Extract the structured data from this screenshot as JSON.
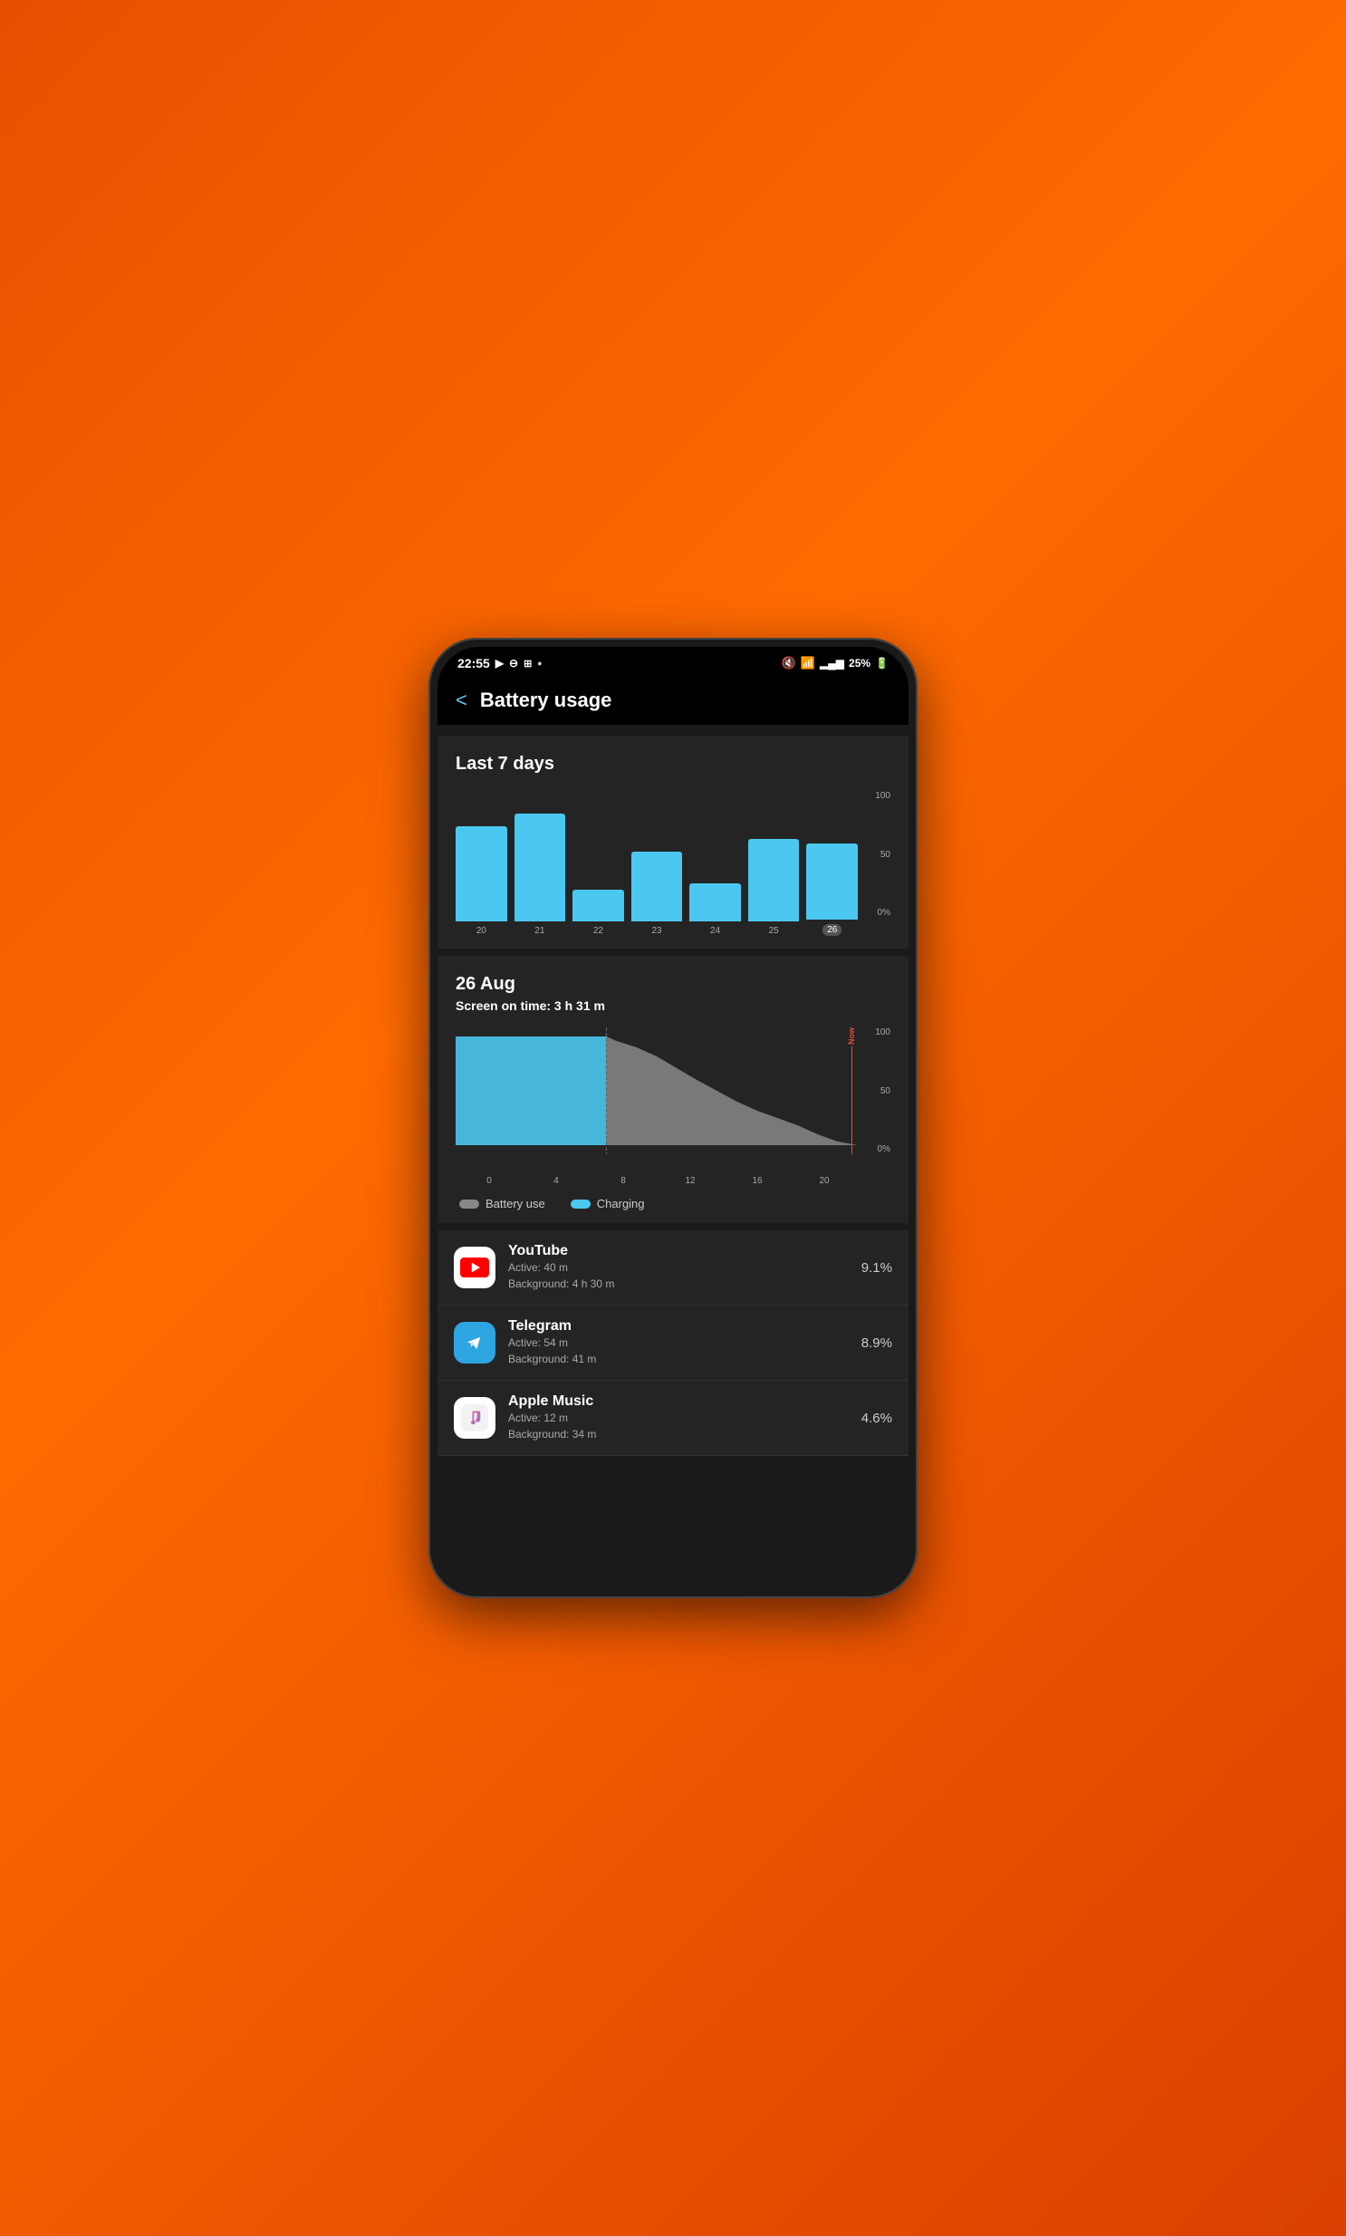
{
  "statusBar": {
    "time": "22:55",
    "battery": "25%",
    "icons": [
      "media",
      "dnd",
      "cast",
      "dot"
    ]
  },
  "header": {
    "back": "<",
    "title": "Battery usage"
  },
  "last7days": {
    "title": "Last 7 days",
    "bars": [
      {
        "day": "20",
        "height": 75,
        "active": false
      },
      {
        "day": "21",
        "height": 85,
        "active": false
      },
      {
        "day": "22",
        "height": 25,
        "active": false
      },
      {
        "day": "23",
        "height": 55,
        "active": false
      },
      {
        "day": "24",
        "height": 30,
        "active": false
      },
      {
        "day": "25",
        "height": 65,
        "active": false
      },
      {
        "day": "26",
        "height": 60,
        "active": true
      }
    ],
    "yLabels": [
      "100",
      "50",
      "0%"
    ]
  },
  "dayDetail": {
    "date": "26 Aug",
    "screenOnTime": "Screen on time: 3 h 31 m",
    "xLabels": [
      "0",
      "4",
      "8",
      "12",
      "16",
      "20"
    ],
    "yLabels": [
      "100",
      "50",
      "0%"
    ],
    "nowLabel": "Now",
    "legend": {
      "batteryUse": "Battery use",
      "charging": "Charging"
    }
  },
  "apps": [
    {
      "name": "YouTube",
      "active": "Active: 40 m",
      "background": "Background: 4 h 30 m",
      "percent": "9.1%",
      "icon": "youtube"
    },
    {
      "name": "Telegram",
      "active": "Active: 54 m",
      "background": "Background: 41 m",
      "percent": "8.9%",
      "icon": "telegram"
    },
    {
      "name": "Apple Music",
      "active": "Active: 12 m",
      "background": "Background: 34 m",
      "percent": "4.6%",
      "icon": "apple-music"
    }
  ]
}
